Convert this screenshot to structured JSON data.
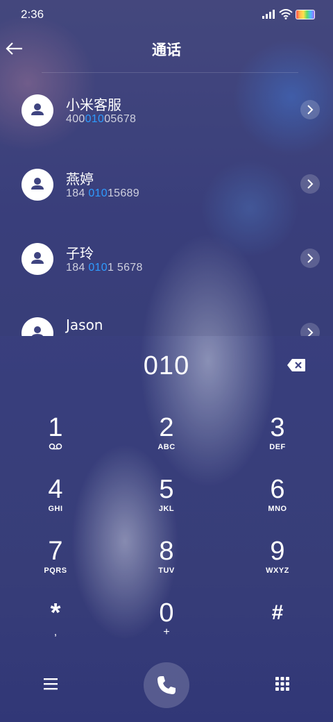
{
  "status_bar": {
    "time": "2:36"
  },
  "header": {
    "title": "通话"
  },
  "contacts": [
    {
      "name": "小米客服",
      "number_pre": "400",
      "number_hl": "010",
      "number_post": "05678"
    },
    {
      "name": "燕婷",
      "number_pre": "184 ",
      "number_hl": "010",
      "number_post": "15689"
    },
    {
      "name": "子玲",
      "number_pre": "184 ",
      "number_hl": "010",
      "number_post": "1 5678"
    },
    {
      "name": "Jason",
      "number_pre": "",
      "number_hl": "",
      "number_post": ""
    }
  ],
  "dialer": {
    "entered": "010",
    "keys": [
      {
        "digit": "1",
        "sub": "voicemail"
      },
      {
        "digit": "2",
        "sub": "ABC"
      },
      {
        "digit": "3",
        "sub": "DEF"
      },
      {
        "digit": "4",
        "sub": "GHI"
      },
      {
        "digit": "5",
        "sub": "JKL"
      },
      {
        "digit": "6",
        "sub": "MNO"
      },
      {
        "digit": "7",
        "sub": "PQRS"
      },
      {
        "digit": "8",
        "sub": "TUV"
      },
      {
        "digit": "9",
        "sub": "WXYZ"
      },
      {
        "digit": "*",
        "sub": ","
      },
      {
        "digit": "0",
        "sub": "+"
      },
      {
        "digit": "#",
        "sub": ""
      }
    ]
  },
  "colors": {
    "highlight": "#2e9bff"
  }
}
